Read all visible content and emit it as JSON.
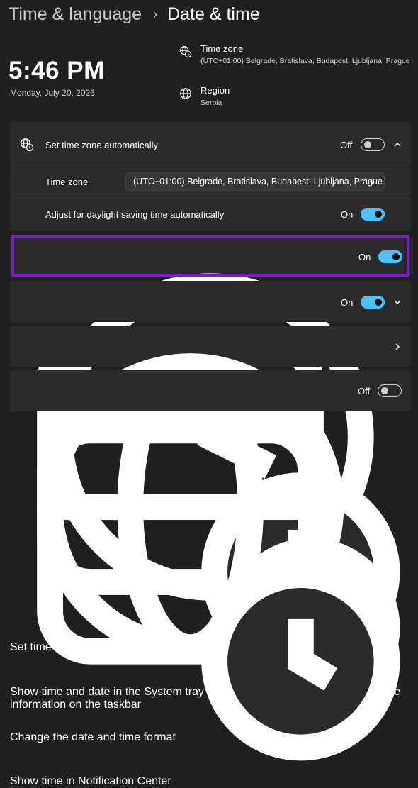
{
  "breadcrumb": {
    "parent": "Time & language",
    "separator": "›",
    "current": "Date & time"
  },
  "clock": {
    "time": "5:46 PM",
    "date": "Monday, July 20, 2026"
  },
  "info": {
    "timezone": {
      "title": "Time zone",
      "value": "(UTC+01:00) Belgrade, Bratislava, Budapest, Ljubljana, Prague",
      "icon": "globe-clock-icon"
    },
    "region": {
      "title": "Region",
      "value": "Serbia",
      "icon": "globe-icon"
    }
  },
  "settings": {
    "auto_timezone": {
      "label": "Set time zone automatically",
      "state": "Off",
      "icon": "globe-clock-icon"
    },
    "timezone_select": {
      "label": "Time zone",
      "value": "(UTC+01:00) Belgrade, Bratislava, Budapest, Ljubljana, Prague"
    },
    "daylight": {
      "label": "Adjust for daylight saving time automatically",
      "state": "On"
    },
    "auto_time": {
      "label": "Set time automatically",
      "state": "On",
      "icon": "clock-icon"
    },
    "system_tray": {
      "label": "Show time and date in the System tray",
      "sub": "Turn this off to hide your time and date information on the taskbar",
      "state": "On",
      "icon": "calendar-clock-icon"
    },
    "format": {
      "label": "Change the date and time format",
      "icon": "globe-settings-icon"
    },
    "notification": {
      "label": "Show time in Notification Center",
      "state": "Off",
      "icon": "notification-clock-icon"
    }
  },
  "colors": {
    "accent": "#4cc2ff",
    "highlight": "#7a1fc8",
    "background": "#202020",
    "card": "#2b2b2b"
  }
}
